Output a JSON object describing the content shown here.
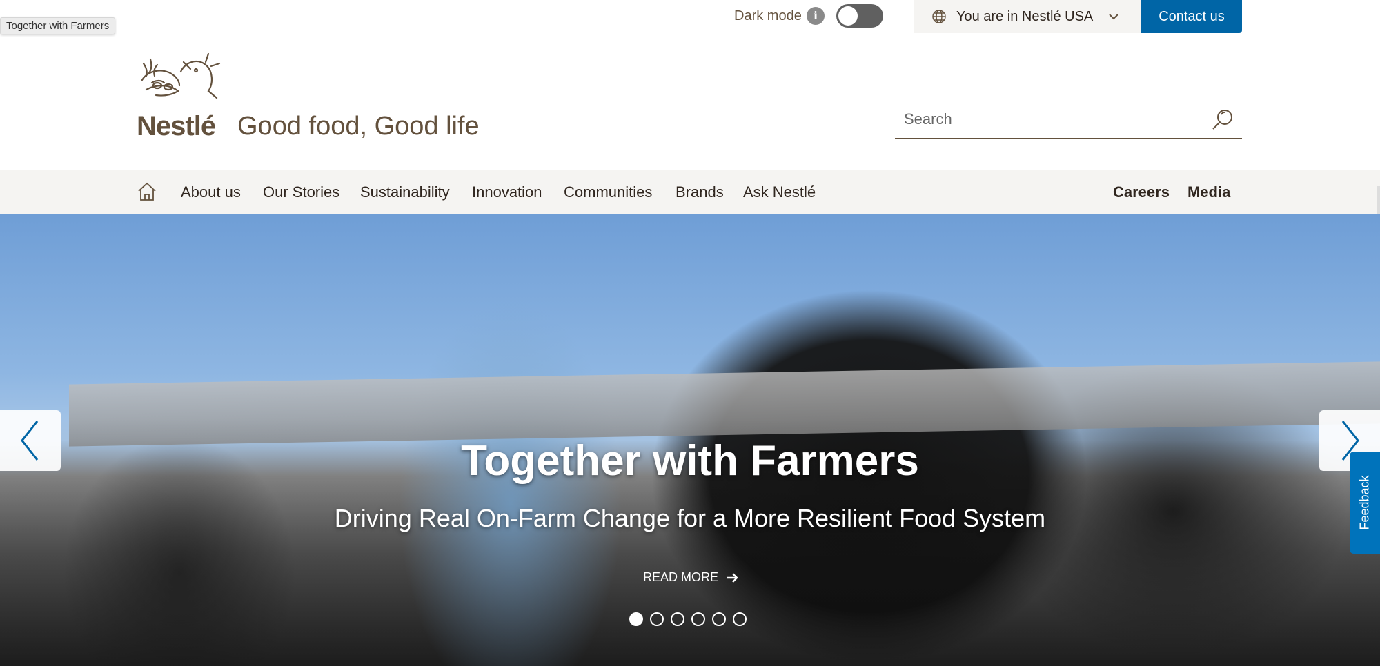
{
  "tooltip": "Together with Farmers",
  "topbar": {
    "dark_mode_label": "Dark mode",
    "country_label": "You are in Nestlé USA",
    "contact_label": "Contact us"
  },
  "brand": {
    "tagline": "Good food, Good life",
    "logo_text": "Nestlé"
  },
  "search": {
    "placeholder": "Search"
  },
  "nav": {
    "items": [
      "About us",
      "Our Stories",
      "Sustainability",
      "Innovation",
      "Communities",
      "Brands",
      "Ask Nestlé"
    ],
    "right_items": [
      "Careers",
      "Media"
    ]
  },
  "hero": {
    "title": "Together with Farmers",
    "subtitle": "Driving Real On-Farm Change for a More Resilient Food System",
    "cta": "READ MORE",
    "slides_total": 6,
    "active_slide": 1
  },
  "feedback_label": "Feedback",
  "colors": {
    "brand_brown": "#63513d",
    "accent_blue": "#0065a6",
    "nav_bg": "#f5f4f2"
  }
}
